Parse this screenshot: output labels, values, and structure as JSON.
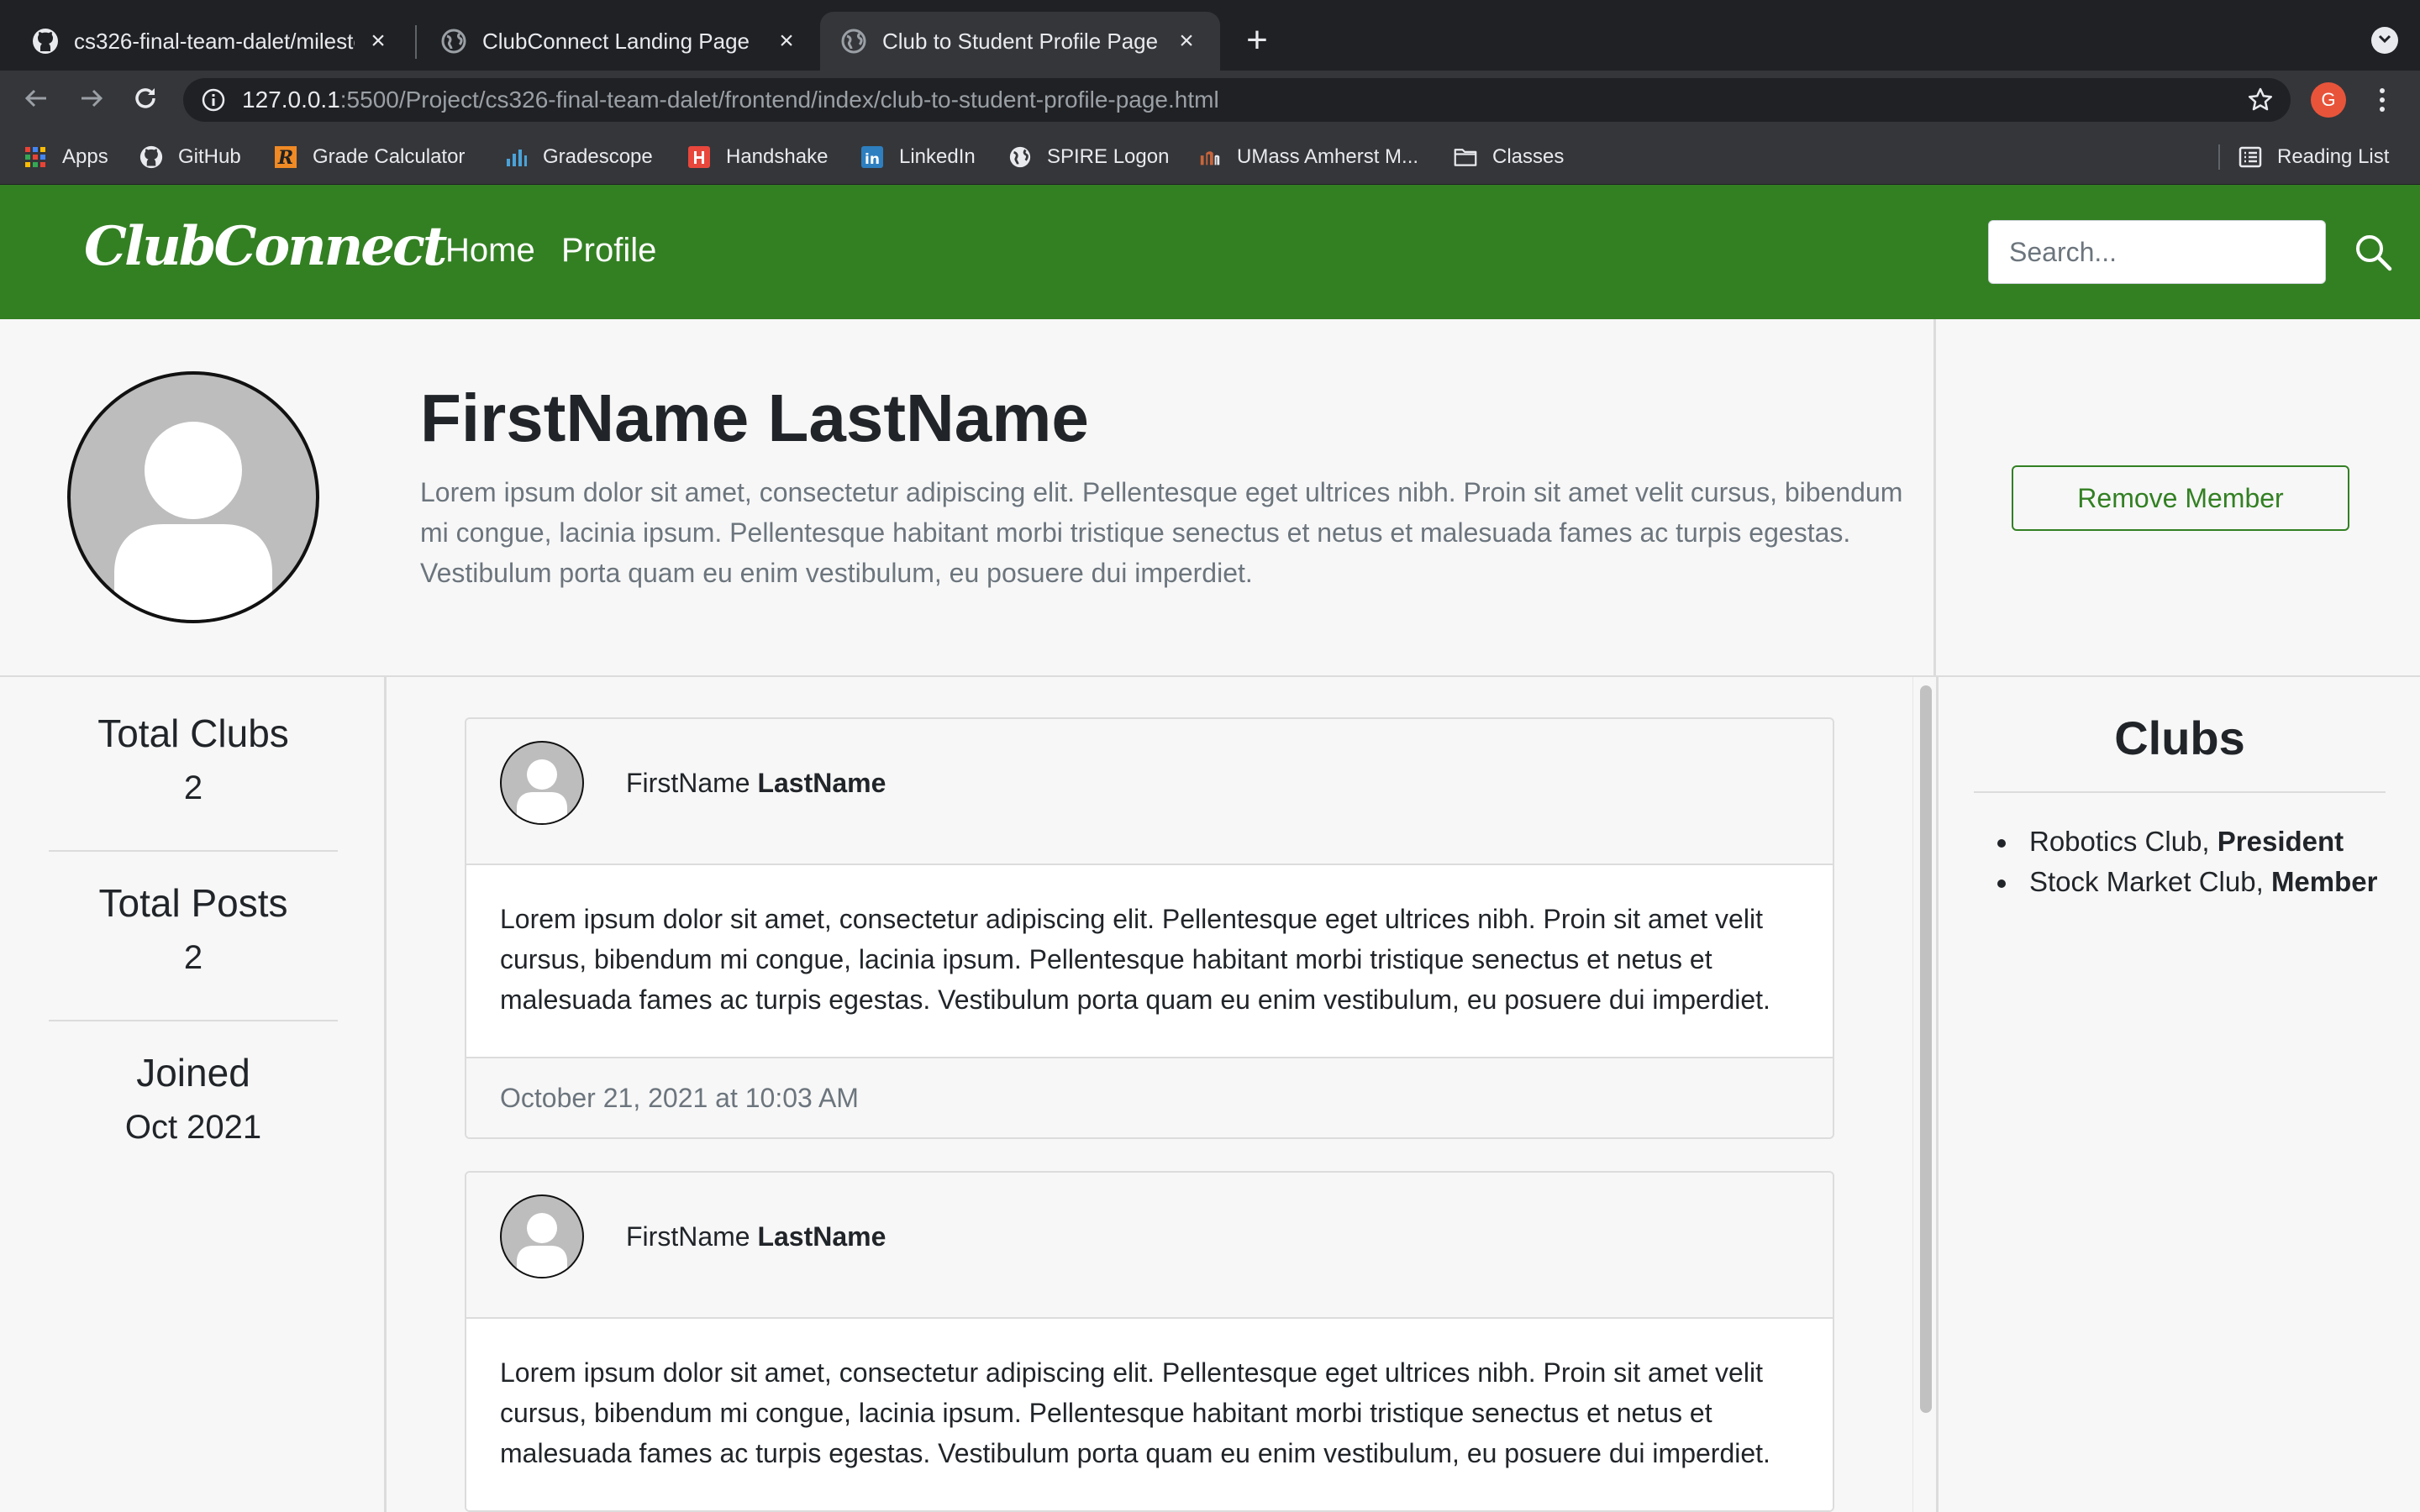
{
  "browser": {
    "tabs": [
      {
        "title": "cs326-final-team-dalet/milestone",
        "favicon": "github-icon",
        "active": false
      },
      {
        "title": "ClubConnect Landing Page",
        "favicon": "globe-icon",
        "active": false
      },
      {
        "title": "Club to Student Profile Page",
        "favicon": "globe-icon",
        "active": true
      }
    ],
    "new_tab_label": "+",
    "url_host": "127.0.0.1",
    "url_path": ":5500/Project/cs326-final-team-dalet/frontend/index/club-to-student-profile-page.html",
    "profile_initial": "G",
    "bookmarks": [
      {
        "label": "Apps",
        "icon": "apps-grid-icon"
      },
      {
        "label": "GitHub",
        "icon": "github-icon"
      },
      {
        "label": "Grade Calculator",
        "icon": "grade-calculator-icon"
      },
      {
        "label": "Gradescope",
        "icon": "gradescope-icon"
      },
      {
        "label": "Handshake",
        "icon": "handshake-icon"
      },
      {
        "label": "LinkedIn",
        "icon": "linkedin-icon"
      },
      {
        "label": "SPIRE Logon",
        "icon": "globe-icon"
      },
      {
        "label": "UMass Amherst M...",
        "icon": "umass-icon"
      },
      {
        "label": "Classes",
        "icon": "folder-icon"
      }
    ],
    "reading_list_label": "Reading List"
  },
  "site": {
    "brand": "ClubConnect",
    "nav_home": "Home",
    "nav_profile": "Profile",
    "search_placeholder": "Search..."
  },
  "profile": {
    "first_name": "FirstName",
    "last_name": "LastName",
    "bio": "Lorem ipsum dolor sit amet, consectetur adipiscing elit. Pellentesque eget ultrices nibh. Proin sit amet velit cursus, bibendum mi congue, lacinia ipsum. Pellentesque habitant morbi tristique senectus et netus et malesuada fames ac turpis egestas. Vestibulum porta quam eu enim vestibulum, eu posuere dui imperdiet.",
    "remove_button": "Remove Member"
  },
  "stats": {
    "total_clubs_label": "Total Clubs",
    "total_clubs_value": "2",
    "total_posts_label": "Total Posts",
    "total_posts_value": "2",
    "joined_label": "Joined",
    "joined_value": "Oct 2021"
  },
  "posts": [
    {
      "first_name": "FirstName",
      "last_name": "LastName",
      "body": "Lorem ipsum dolor sit amet, consectetur adipiscing elit. Pellentesque eget ultrices nibh. Proin sit amet velit cursus, bibendum mi congue, lacinia ipsum. Pellentesque habitant morbi tristique senectus et netus et malesuada fames ac turpis egestas. Vestibulum porta quam eu enim vestibulum, eu posuere dui imperdiet.",
      "timestamp": "October 21, 2021 at 10:03 AM"
    },
    {
      "first_name": "FirstName",
      "last_name": "LastName",
      "body": "Lorem ipsum dolor sit amet, consectetur adipiscing elit. Pellentesque eget ultrices nibh. Proin sit amet velit cursus, bibendum mi congue, lacinia ipsum. Pellentesque habitant morbi tristique senectus et netus et malesuada fames ac turpis egestas. Vestibulum porta quam eu enim vestibulum, eu posuere dui imperdiet."
    }
  ],
  "clubs": {
    "title": "Clubs",
    "items": [
      {
        "name": "Robotics Club, ",
        "role": "President"
      },
      {
        "name": "Stock Market Club, ",
        "role": "Member"
      }
    ]
  },
  "colors": {
    "brand_green": "#338023",
    "chrome_dark": "#202124",
    "chrome_mid": "#35363a",
    "page_bg": "#f7f7f7"
  }
}
